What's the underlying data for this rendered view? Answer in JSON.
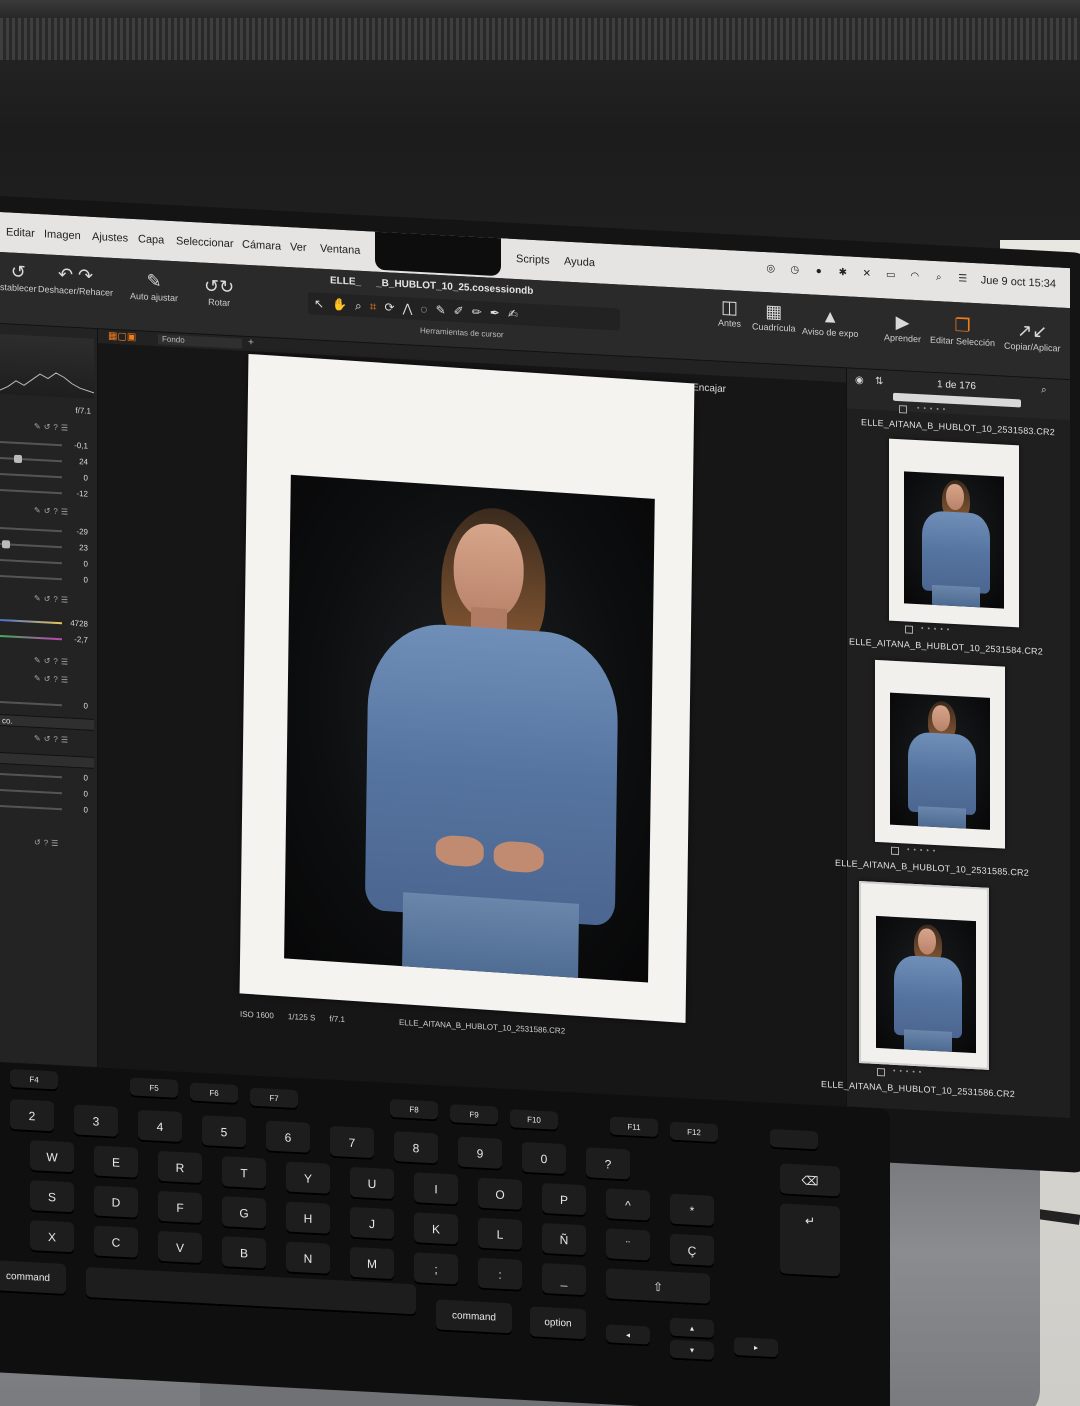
{
  "menubar": {
    "items": [
      "Editar",
      "Imagen",
      "Ajustes",
      "Capa",
      "Seleccionar",
      "Cámara",
      "Ver",
      "Ventana",
      "Scripts",
      "Ayuda"
    ],
    "clock": "Jue 9 oct 15:34"
  },
  "toolbar": {
    "document_title": "ELLE_   _B_HUBLOT_10_25.cosessiondb",
    "buttons": {
      "restore": "stablecer",
      "undo_redo": "Deshacer/Rehacer",
      "auto_adjust": "Auto ajustar",
      "rotate": "Rotar",
      "before": "Antes",
      "grid": "Cuadrícula",
      "exposure_warning": "Aviso de expo",
      "learn": "Aprender",
      "edit_selection": "Editar Selección",
      "copy_apply": "Copiar/Aplicar"
    },
    "cursor_tools_caption": "Herramientas de cursor"
  },
  "left_panel": {
    "exposure_values": [
      "f/7.1"
    ],
    "group1": [
      "-0,1",
      "24",
      "0",
      "-12"
    ],
    "group2": [
      "-29",
      "23",
      "0",
      "0"
    ],
    "white_balance": [
      "4728",
      "-2,7"
    ],
    "group3": [
      "0"
    ],
    "group4_label": "co.",
    "group4": [
      "0"
    ],
    "group5": [
      "0",
      "0",
      "0"
    ]
  },
  "viewer": {
    "background_label": "Fondo",
    "fit_label": "Encajar",
    "meta": {
      "iso": "ISO 1600",
      "shutter": "1/125 S",
      "aperture": "f/7.1",
      "filename": "ELLE_AITANA_B_HUBLOT_10_2531586.CR2"
    }
  },
  "browser": {
    "counter": "1 de 176",
    "thumbnails": [
      {
        "caption": "ELLE_AITANA_B_HUBLOT_10_2531583.CR2"
      },
      {
        "caption": "ELLE_AITANA_B_HUBLOT_10_2531584.CR2"
      },
      {
        "caption": "ELLE_AITANA_B_HUBLOT_10_2531585.CR2"
      },
      {
        "caption": "ELLE_AITANA_B_HUBLOT_10_2531586.CR2"
      }
    ]
  },
  "keyboard": {
    "row_numbers": [
      "2",
      "3",
      "4",
      "5",
      "6",
      "7",
      "8",
      "9",
      "0",
      "?"
    ],
    "row_top": [
      "W",
      "E",
      "R",
      "T",
      "Y",
      "U",
      "I",
      "O",
      "P",
      "^",
      "*"
    ],
    "row_home": [
      "S",
      "D",
      "F",
      "G",
      "H",
      "J",
      "K",
      "L",
      "Ñ",
      "¨",
      "Ç"
    ],
    "row_bottom": [
      "X",
      "C",
      "V",
      "B",
      "N",
      "M",
      ";",
      ":",
      "_"
    ],
    "command_left": "command",
    "command_right": "command",
    "option": "option"
  }
}
